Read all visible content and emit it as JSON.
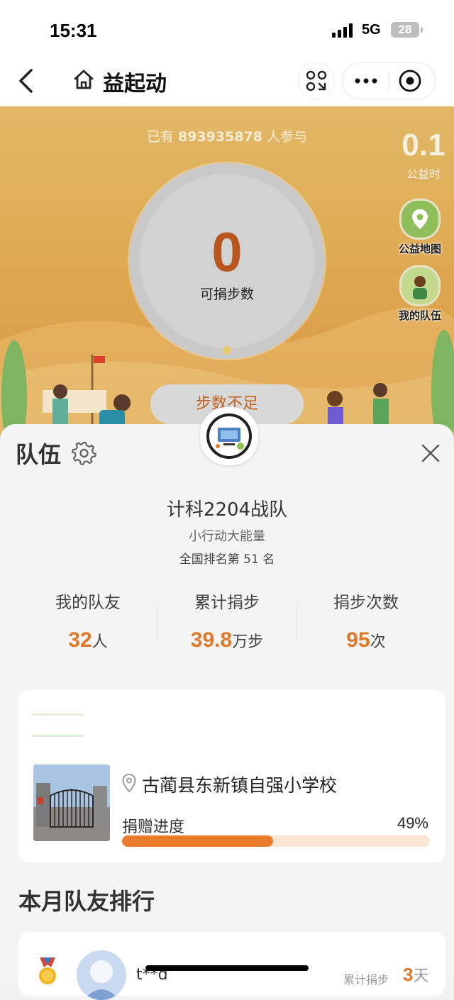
{
  "status_bar": {
    "time": "15:31",
    "network": "5G",
    "battery": "28"
  },
  "nav": {
    "title": "益起动"
  },
  "hero": {
    "participants_prefix": "已有",
    "participants_count": "893935878",
    "participants_suffix": "人参与",
    "welfare_hours_value": "0.1",
    "welfare_hours_label": "公益时",
    "map_label": "公益地图",
    "my_team_label": "我的队伍",
    "donatable_steps": "0",
    "donatable_steps_label": "可捐步数",
    "donate_button": "步数不足"
  },
  "team": {
    "header": "队伍",
    "name": "计科2204战队",
    "slogan": "小行动大能量",
    "rank_prefix": "全国排名第",
    "rank_value": "51",
    "rank_suffix": "名",
    "stats": [
      {
        "label": "我的队友",
        "value": "32",
        "unit": "人"
      },
      {
        "label": "累计捐步",
        "value": "39.8",
        "unit": "万步"
      },
      {
        "label": "捐步次数",
        "value": "95",
        "unit": "次"
      }
    ]
  },
  "project": {
    "school": "古蔺县东新镇自强小学校",
    "progress_label": "捐赠进度",
    "progress_text": "49%",
    "progress_fraction": 0.49
  },
  "ranking": {
    "title": "本月队友排行",
    "first": {
      "user": "t**d",
      "cum_label": "累计捐步",
      "days_value": "3",
      "days_unit": "天"
    }
  },
  "colors": {
    "accent": "#e07829",
    "progress_track": "#fbe6d6",
    "hero_top": "#e2b866"
  }
}
